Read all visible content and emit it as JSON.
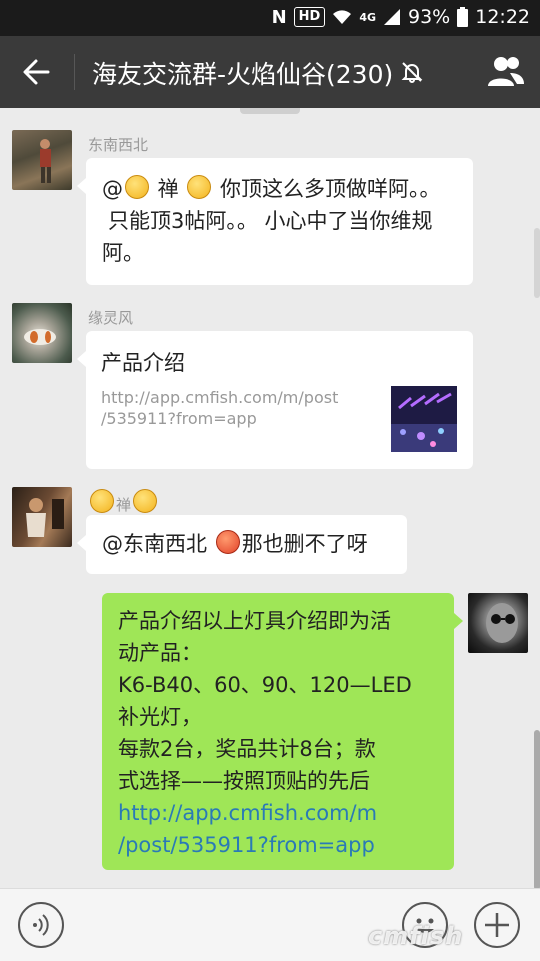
{
  "status_bar": {
    "battery": "93%",
    "time": "12:22",
    "hd_label": "HD",
    "network": "4G"
  },
  "header": {
    "title": "海友交流群-火焰仙谷(230)"
  },
  "messages": [
    {
      "sender": "东南西北",
      "line1_a": "@",
      "line1_b": " 禅 ",
      "line1_c": " 你顶这么多顶做咩阿。。",
      "line2": "只能顶3帖阿。。 小心中了当你维规",
      "line3": "阿。"
    },
    {
      "sender": "缘灵风",
      "link_title": "产品介绍",
      "link_url_1": "http://app.cmfish.com/m/post",
      "link_url_2": "/535911?from=app"
    },
    {
      "sender_name": "禅",
      "text_a": "@东南西北 ",
      "text_b": "那也删不了呀"
    },
    {
      "lines": [
        "产品介绍以上灯具介绍即为活",
        "动产品：",
        "K6-B40、60、90、120—LED",
        "补光灯，",
        "每款2台，奖品共计8台；款",
        "式选择——按照顶贴的先后"
      ],
      "link_1": "http://app.cmfish.com/m",
      "link_2": "/post/535911?from=app"
    }
  ],
  "watermark": "cmfish"
}
